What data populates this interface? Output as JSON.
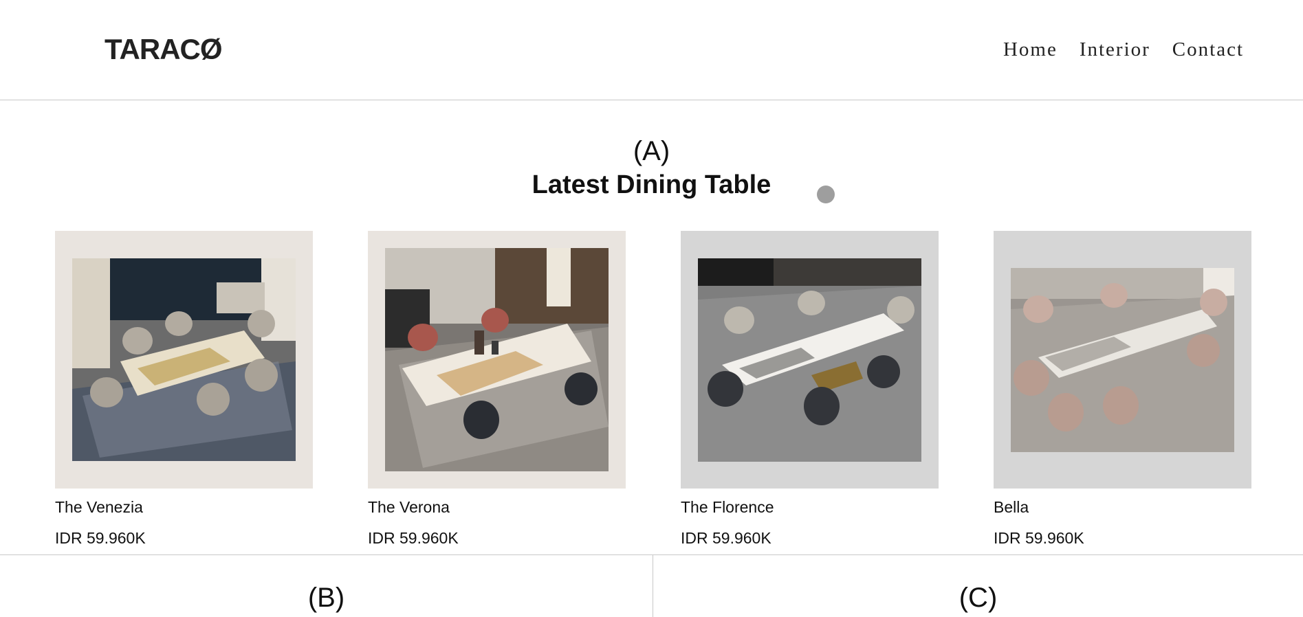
{
  "brand": {
    "logo": "TARACØ"
  },
  "nav": {
    "items": [
      "Home",
      "Interior",
      "Contact"
    ]
  },
  "section_a": {
    "label": "(A)",
    "title": "Latest Dining Table"
  },
  "products": [
    {
      "name": "The Venezia",
      "price": "IDR 59.960K"
    },
    {
      "name": "The Verona",
      "price": "IDR 59.960K"
    },
    {
      "name": "The Florence",
      "price": "IDR 59.960K"
    },
    {
      "name": "Bella",
      "price": "IDR 59.960K"
    }
  ],
  "section_b": {
    "label": "(B)"
  },
  "section_c": {
    "label": "(C)"
  },
  "colors": {
    "card_bg_warm": "#e9e4df",
    "card_bg_gray": "#d6d6d6",
    "divider": "#c8c8c8",
    "text": "#111111"
  }
}
